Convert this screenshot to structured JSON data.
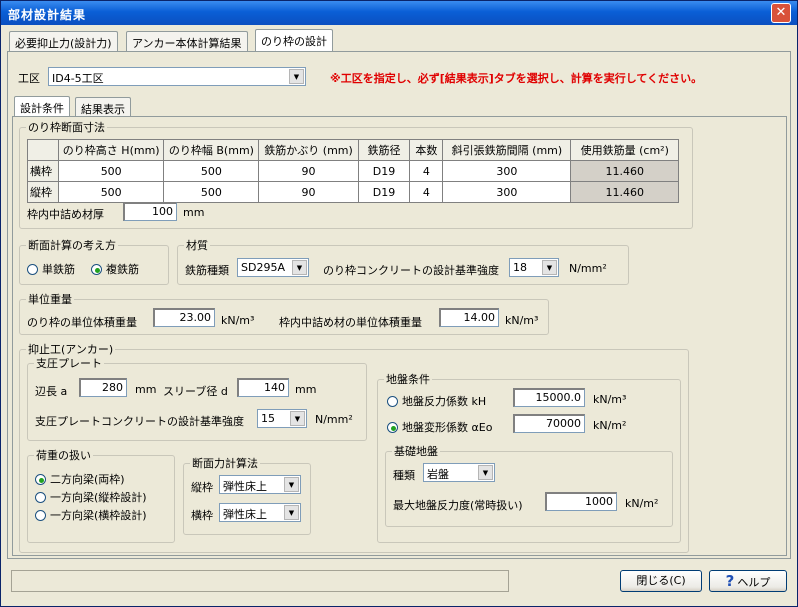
{
  "window": {
    "title": "部材設計結果",
    "close_glyph": "✕"
  },
  "top_tabs": [
    {
      "label": "必要抑止力(設計力)"
    },
    {
      "label": "アンカー本体計算結果"
    },
    {
      "label": "のり枠の設計"
    }
  ],
  "section": {
    "label": "工区",
    "value": "ID4-5工区",
    "notice": "※工区を指定し、必ず[結果表示]タブを選択し、計算を実行してください。"
  },
  "sub_tabs": [
    {
      "label": "設計条件"
    },
    {
      "label": "結果表示"
    }
  ],
  "frame_dims": {
    "legend": "のり枠断面寸法",
    "columns": [
      "",
      "のり枠高さ H(mm)",
      "のり枠幅 B(mm)",
      "鉄筋かぶり (mm)",
      "鉄筋径",
      "本数",
      "斜引張鉄筋間隔 (mm)",
      "使用鉄筋量 (cm²)"
    ],
    "rows": [
      {
        "name": "横枠",
        "cells": [
          "500",
          "500",
          "90",
          "D19",
          "4",
          "300",
          "11.460"
        ]
      },
      {
        "name": "縦枠",
        "cells": [
          "500",
          "500",
          "90",
          "D19",
          "4",
          "300",
          "11.460"
        ]
      }
    ],
    "infill_label": "枠内中詰め材厚",
    "infill_value": "100",
    "infill_unit": "mm"
  },
  "calc_method": {
    "legend": "断面計算の考え方",
    "options": [
      "単鉄筋",
      "複鉄筋"
    ],
    "selected": "複鉄筋"
  },
  "material": {
    "legend": "材質",
    "rebar_label": "鉄筋種類",
    "rebar_value": "SD295A",
    "concrete_label": "のり枠コンクリートの設計基準強度",
    "concrete_value": "18",
    "concrete_unit": "N/mm²"
  },
  "unit_weight": {
    "legend": "単位重量",
    "frame_label": "のり枠の単位体積重量",
    "frame_value": "23.00",
    "frame_unit": "kN/m³",
    "infill_label": "枠内中詰め材の単位体積重量",
    "infill_value": "14.00",
    "infill_unit": "kN/m³"
  },
  "anchor": {
    "legend": "抑止工(アンカー)",
    "plate": {
      "legend": "支圧プレート",
      "side_label": "辺長 a",
      "side_value": "280",
      "side_unit": "mm",
      "sleeve_label": "スリーブ径 d",
      "sleeve_value": "140",
      "sleeve_unit": "mm",
      "strength_label": "支圧プレートコンクリートの設計基準強度",
      "strength_value": "15",
      "strength_unit": "N/mm²"
    },
    "load": {
      "legend": "荷重の扱い",
      "options": [
        "二方向梁(両枠)",
        "一方向梁(縦枠設計)",
        "一方向梁(横枠設計)"
      ],
      "selected": "二方向梁(両枠)"
    },
    "section_force": {
      "legend": "断面力計算法",
      "vertical_label": "縦枠",
      "vertical_value": "弾性床上",
      "horizontal_label": "横枠",
      "horizontal_value": "弾性床上"
    },
    "ground": {
      "legend": "地盤条件",
      "opt1_label": "地盤反力係数 kH",
      "opt1_value": "15000.0",
      "opt1_unit": "kN/m³",
      "opt2_label": "地盤変形係数 αEo",
      "opt2_value": "70000",
      "opt2_unit": "kN/m²",
      "selected": "opt2",
      "base": {
        "legend": "基礎地盤",
        "kind_label": "種類",
        "kind_value": "岩盤",
        "max_label": "最大地盤反力度(常時扱い)",
        "max_value": "1000",
        "max_unit": "kN/m²"
      }
    }
  },
  "footer": {
    "close_label": "閉じる(C)",
    "help_label": "ヘルプ",
    "help_glyph": "?"
  }
}
